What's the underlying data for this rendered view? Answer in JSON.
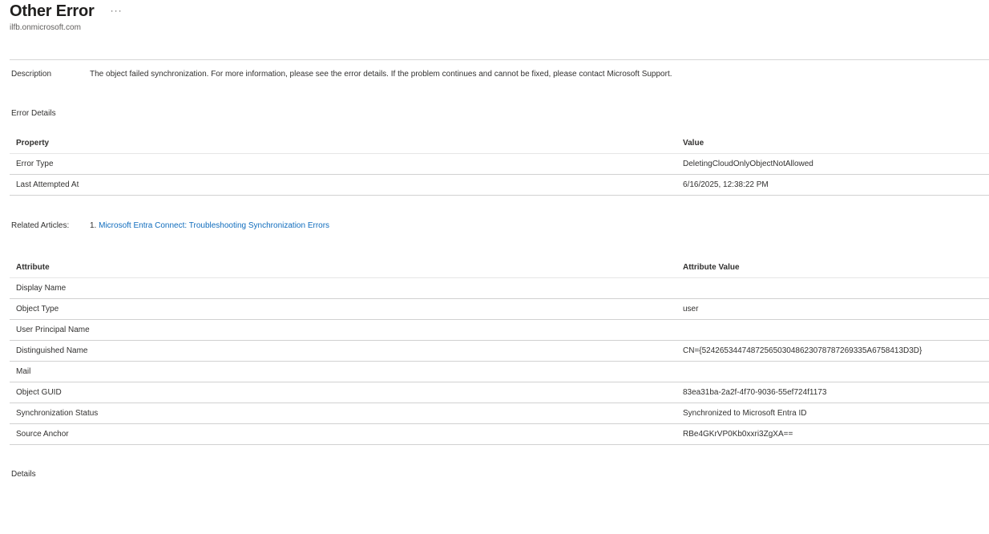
{
  "header": {
    "title": "Other Error",
    "more_label": "···",
    "subtitle": "ilfb.onmicrosoft.com"
  },
  "description": {
    "label": "Description",
    "text": "The object failed synchronization. For more information, please see the error details. If the problem continues and cannot be fixed, please contact Microsoft Support."
  },
  "error_details": {
    "label": "Error Details",
    "columns": [
      "Property",
      "Value"
    ],
    "rows": [
      [
        "Error Type",
        "DeletingCloudOnlyObjectNotAllowed"
      ],
      [
        "Last Attempted At",
        "6/16/2025, 12:38:22 PM"
      ]
    ]
  },
  "related_articles": {
    "label": "Related Articles:",
    "items": [
      {
        "number": "1.",
        "text": "Microsoft Entra Connect: Troubleshooting Synchronization Errors"
      }
    ]
  },
  "attributes": {
    "columns": [
      "Attribute",
      "Attribute Value"
    ],
    "rows": [
      [
        "Display Name",
        ""
      ],
      [
        "Object Type",
        "user"
      ],
      [
        "User Principal Name",
        ""
      ],
      [
        "Distinguished Name",
        "CN={5242653447487256503048623078787269335A6758413D3D}"
      ],
      [
        "Mail",
        ""
      ],
      [
        "Object GUID",
        "83ea31ba-2a2f-4f70-9036-55ef724f1173"
      ],
      [
        "Synchronization Status",
        "Synchronized to Microsoft Entra ID"
      ],
      [
        "Source Anchor",
        "RBe4GKrVP0Kb0xxri3ZgXA=="
      ]
    ]
  },
  "details": {
    "label": "Details"
  }
}
